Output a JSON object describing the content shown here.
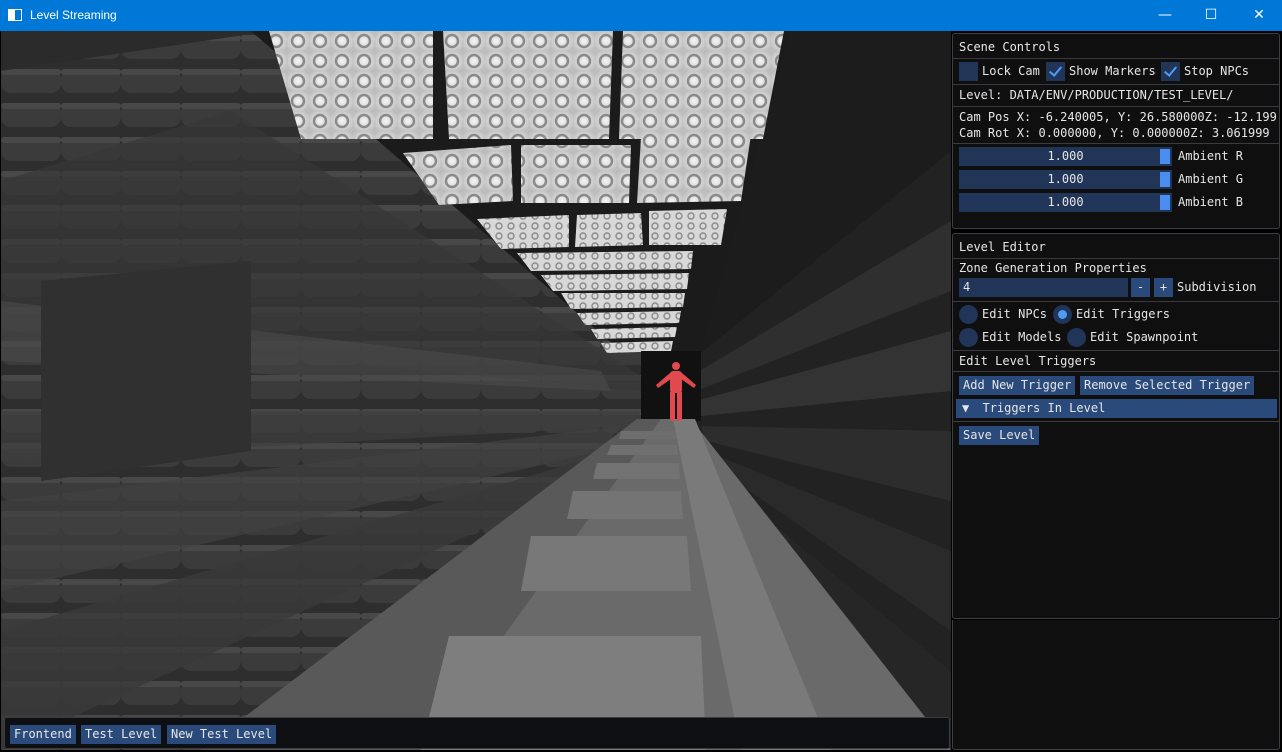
{
  "window": {
    "title": "Level Streaming",
    "minimize": "—",
    "maximize": "☐",
    "close": "✕"
  },
  "level_bar": {
    "buttons": [
      "Frontend",
      "Test Level",
      "New Test Level"
    ]
  },
  "scene_controls": {
    "title": "Scene Controls",
    "lock_cam": {
      "label": "Lock Cam",
      "checked": false
    },
    "show_markers": {
      "label": "Show Markers",
      "checked": true
    },
    "stop_npcs": {
      "label": "Stop NPCs",
      "checked": true
    },
    "level_path": "Level: DATA/ENV/PRODUCTION/TEST_LEVEL/",
    "cam_pos": "Cam Pos X: -6.240005, Y: 26.580000Z: -12.199997",
    "cam_rot": "Cam Rot X: 0.000000, Y: 0.000000Z: 3.061999",
    "ambient": [
      {
        "value": "1.000",
        "label": "Ambient R"
      },
      {
        "value": "1.000",
        "label": "Ambient G"
      },
      {
        "value": "1.000",
        "label": "Ambient B"
      }
    ]
  },
  "level_editor": {
    "title": "Level Editor",
    "zone_header": "Zone Generation Properties",
    "subdivision_value": "4",
    "minus": "-",
    "plus": "+",
    "subdivision_label": "Subdivision",
    "modes": {
      "edit_npcs": {
        "label": "Edit NPCs",
        "selected": false
      },
      "edit_triggers": {
        "label": "Edit Triggers",
        "selected": true
      },
      "edit_models": {
        "label": "Edit Models",
        "selected": false
      },
      "edit_spawnpoint": {
        "label": "Edit Spawnpoint",
        "selected": false
      }
    },
    "triggers_header": "Edit Level Triggers",
    "add_trigger": "Add New Trigger",
    "remove_trigger": "Remove Selected Trigger",
    "triggers_in_level": "Triggers In Level",
    "tree_arrow": "▼",
    "save_level": "Save Level"
  },
  "colors": {
    "titlebar": "#0078d7",
    "button": "#294a7a",
    "frame": "#203557",
    "accent": "#4e9cf7",
    "npc": "#e04a4f"
  }
}
